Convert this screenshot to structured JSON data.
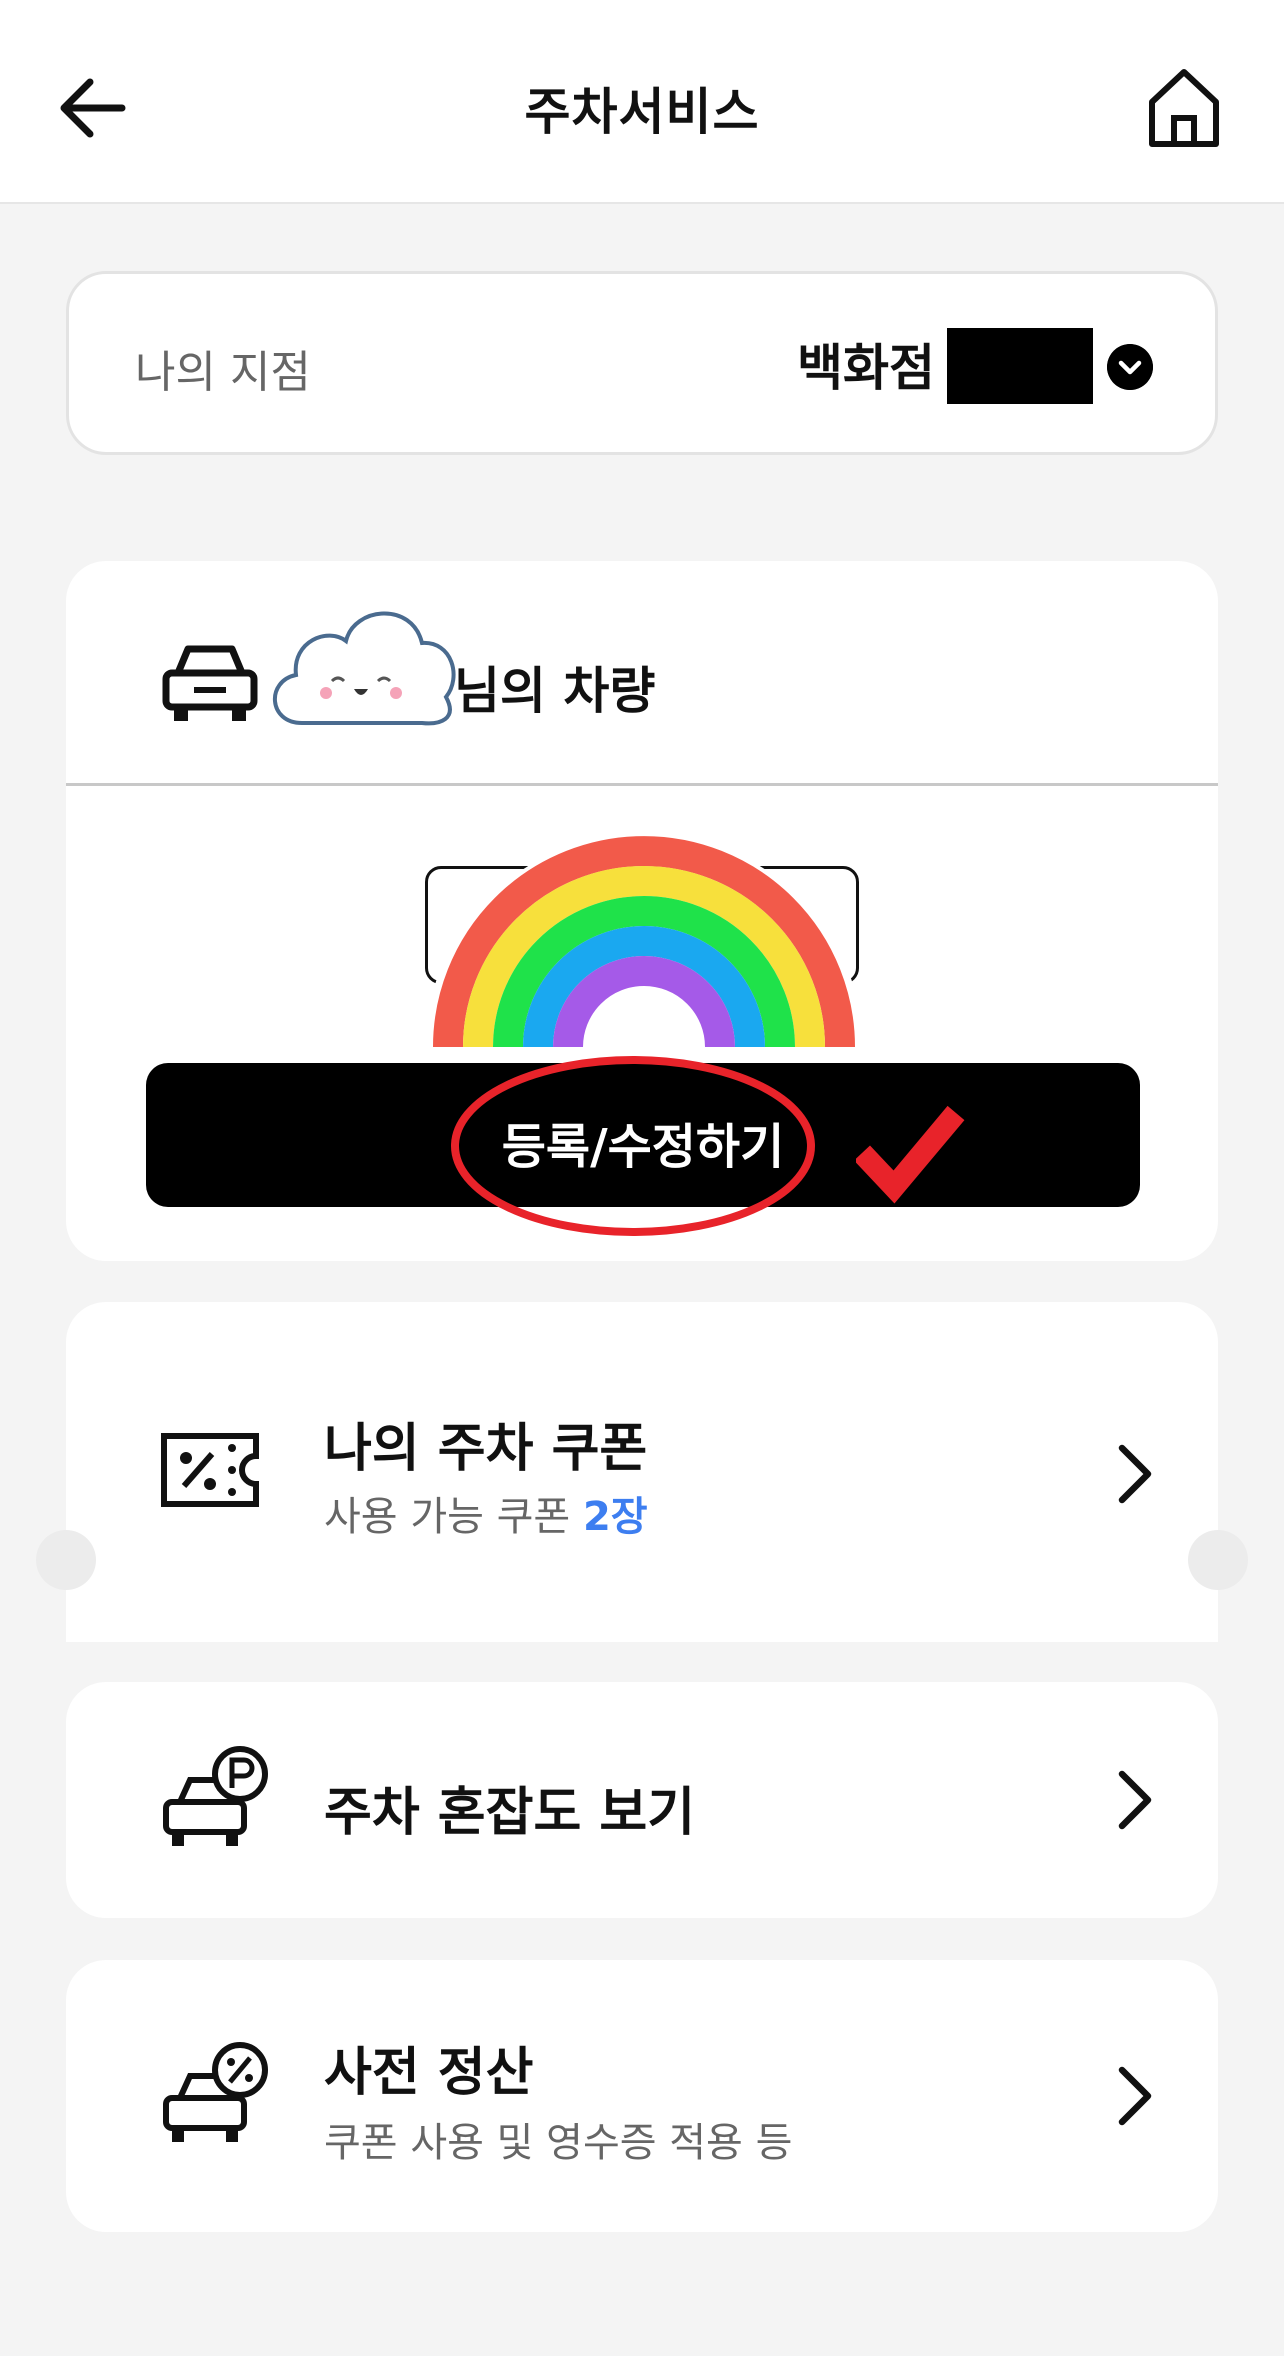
{
  "header": {
    "title": "주차서비스",
    "back_icon": "arrow-left-icon",
    "home_icon": "home-icon"
  },
  "store": {
    "label": "나의 지점",
    "value": "백화점",
    "dropdown_icon": "chevron-down-circle-icon"
  },
  "vehicle": {
    "owner_suffix": "님의 차량",
    "register_button": "등록/수정하기",
    "stickers": [
      "cloud-sticker",
      "rainbow-sticker",
      "red-circle-annotation",
      "red-checkmark-annotation"
    ]
  },
  "coupon": {
    "title": "나의 주차 쿠폰",
    "subtitle_prefix": "사용 가능 쿠폰",
    "count": "2장",
    "accent_color": "#3d7ef0"
  },
  "congestion": {
    "title": "주차 혼잡도 보기"
  },
  "prepay": {
    "title": "사전 정산",
    "subtitle": "쿠폰 사용 및 영수증 적용 등"
  },
  "colors": {
    "background": "#f4f4f4",
    "button": "#000000",
    "annotation_red": "#e8232a"
  }
}
